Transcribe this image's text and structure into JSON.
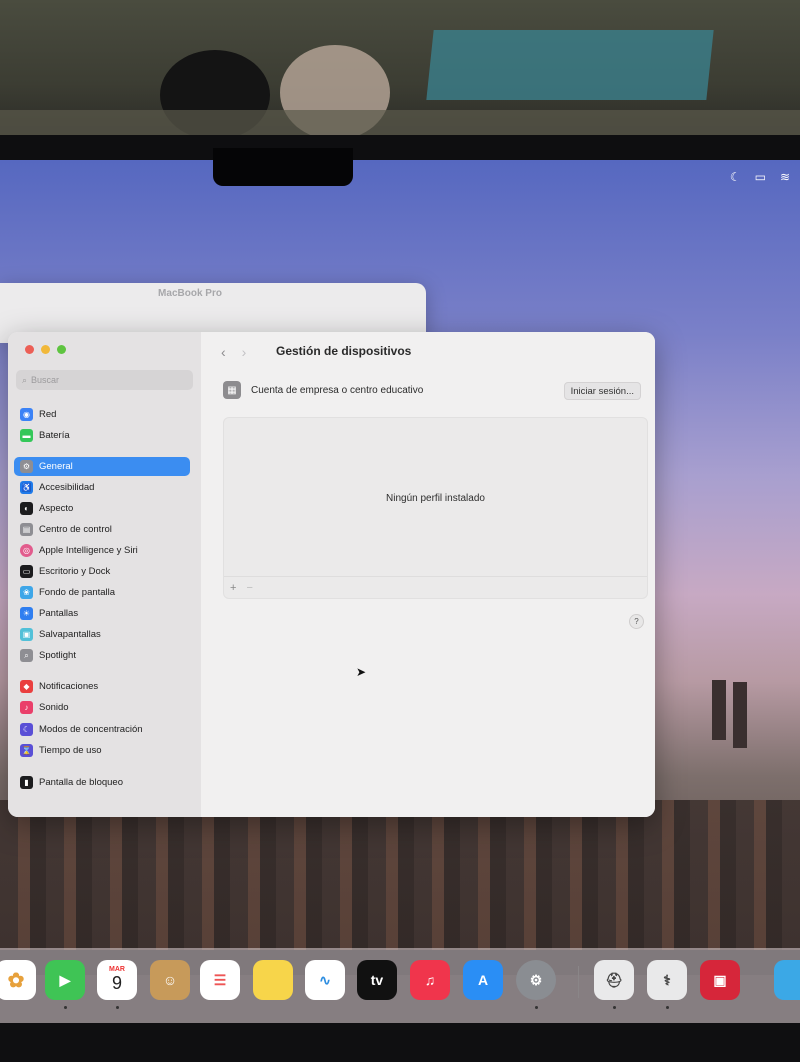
{
  "menubar": {
    "icons": [
      "moon-icon",
      "battery-icon",
      "wifi-icon"
    ]
  },
  "about_window": {
    "title": "MacBook Pro"
  },
  "settings": {
    "search_placeholder": "Buscar",
    "sidebar_items": [
      {
        "label": "Red",
        "icon": "network-icon",
        "color": "#3b82f6"
      },
      {
        "label": "Batería",
        "icon": "battery-icon",
        "color": "#34c759"
      },
      {
        "label": "General",
        "icon": "gear-icon",
        "color": "#8e8e93",
        "selected": true
      },
      {
        "label": "Accesibilidad",
        "icon": "accessibility-icon",
        "color": "#1f7aea"
      },
      {
        "label": "Aspecto",
        "icon": "appearance-icon",
        "color": "#1c1c1e"
      },
      {
        "label": "Centro de control",
        "icon": "control-center-icon",
        "color": "#8e8e93"
      },
      {
        "label": "Apple Intelligence y Siri",
        "icon": "siri-icon",
        "color": "#e25c8d"
      },
      {
        "label": "Escritorio y Dock",
        "icon": "dock-icon",
        "color": "#1c1c1e"
      },
      {
        "label": "Fondo de pantalla",
        "icon": "wallpaper-icon",
        "color": "#3ea6e8"
      },
      {
        "label": "Pantallas",
        "icon": "display-icon",
        "color": "#2f7ef0"
      },
      {
        "label": "Salvapantallas",
        "icon": "screensaver-icon",
        "color": "#52c0d8"
      },
      {
        "label": "Spotlight",
        "icon": "spotlight-icon",
        "color": "#8e8e93"
      },
      {
        "label": "Notificaciones",
        "icon": "notifications-icon",
        "color": "#ea3f3f"
      },
      {
        "label": "Sonido",
        "icon": "sound-icon",
        "color": "#ea3f6a"
      },
      {
        "label": "Modos de concentración",
        "icon": "focus-icon",
        "color": "#5a4fd6"
      },
      {
        "label": "Tiempo de uso",
        "icon": "screen-time-icon",
        "color": "#5a4fd6"
      },
      {
        "label": "Pantalla de bloqueo",
        "icon": "lock-screen-icon",
        "color": "#1c1c1e"
      }
    ],
    "page_title": "Gestión de dispositivos",
    "account_label": "Cuenta de empresa o centro educativo",
    "signin_label": "Iniciar sesión...",
    "empty_profiles": "Ningún perfil instalado",
    "add_symbol": "+",
    "remove_symbol": "−",
    "help_symbol": "?"
  },
  "dock": {
    "calendar_month": "MAR",
    "calendar_day": "9",
    "tv_label": "tv",
    "apps": [
      "photos-icon",
      "facetime-icon",
      "calendar-icon",
      "contacts-icon",
      "reminders-icon",
      "notes-icon",
      "freeform-icon",
      "apple-tv-icon",
      "music-icon",
      "app-store-icon",
      "system-settings-icon",
      "disk-utility-icon",
      "system-information-icon",
      "photo-booth-icon",
      "finder-icon"
    ]
  }
}
